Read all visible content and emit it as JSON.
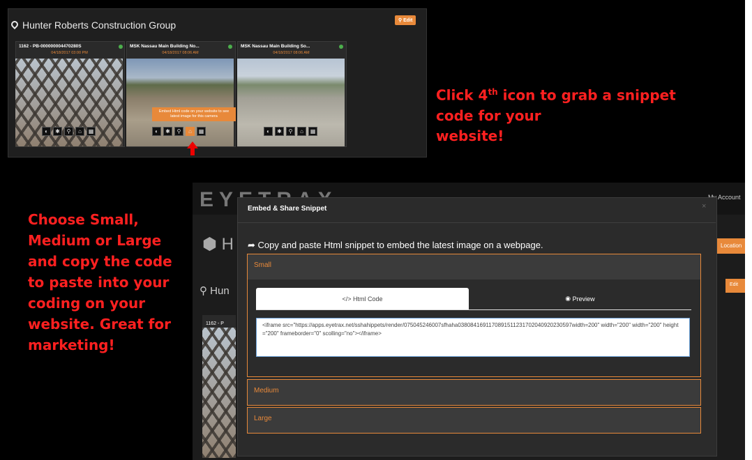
{
  "top_panel": {
    "title": "Hunter Roberts Construction Group",
    "edit_label": "Edit",
    "cards": [
      {
        "title": "1162 - PB-000000004470280S",
        "date": "04/18/2017 03:00 PM"
      },
      {
        "title": "MSK Nassau Main Building No...",
        "date": "04/18/2017 08:06 AM"
      },
      {
        "title": "MSK Nassau Main Building So...",
        "date": "04/18/2017 08:06 AM"
      }
    ],
    "tooltip": "Embed Html code on your website to see latest image for this camera"
  },
  "annotations": {
    "callout_1_pre": "Click 4",
    "callout_1_sup": "th",
    "callout_1_post": " icon to grab a snippet code for your",
    "callout_1_line3": "website!",
    "callout_2": "Choose Small, Medium or Large and copy the code to paste into your coding on your website. Great for marketing!"
  },
  "background_app": {
    "logo": "EYETRAX",
    "my_account": "My Account",
    "heading_partial": "H",
    "hunter_partial": "Hun",
    "card_partial": "1162 - P",
    "location_btn": "Location",
    "edit_btn": "Edit"
  },
  "modal": {
    "title": "Embed & Share Snippet",
    "close": "×",
    "instruction": "Copy and paste Html snippet to embed the latest image on a webpage.",
    "sections": {
      "small": "Small",
      "medium": "Medium",
      "large": "Large"
    },
    "tabs": {
      "html_code": "</> Html Code",
      "preview": "Preview"
    },
    "code": "<iframe src=\"https://apps.eyetrax.net/sshahippets/render/075045246007sfhaha0380841691170891511231702040920230597width=200\" width=\"200\" width=\"200\" height=\"200\" frameborder=\"0\" scolling=\"no\"></iframe>"
  }
}
